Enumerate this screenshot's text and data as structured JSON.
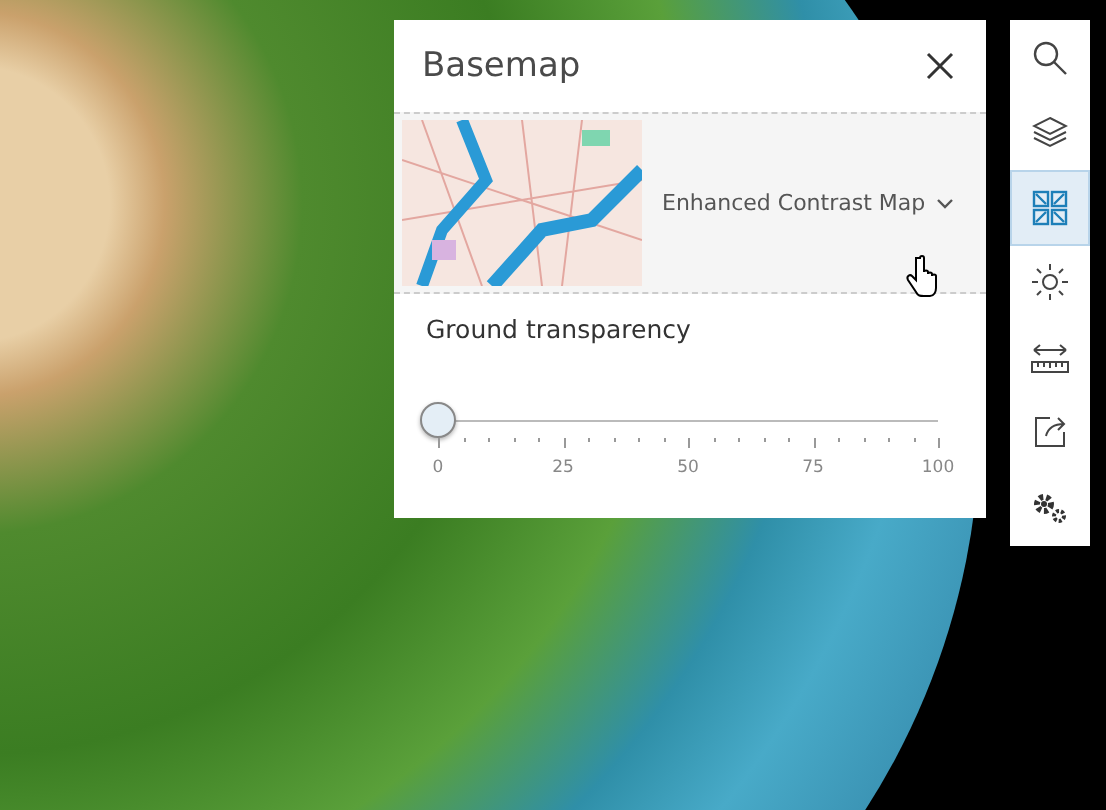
{
  "panel": {
    "title": "Basemap",
    "basemap": {
      "name": "Enhanced Contrast Map"
    },
    "slider": {
      "label": "Ground transparency",
      "level": 0,
      "ticks": [
        "0",
        "25",
        "50",
        "75",
        "100"
      ]
    }
  },
  "toolbar": [
    {
      "kind": "search",
      "selected": false
    },
    {
      "kind": "layers",
      "selected": false
    },
    {
      "kind": "basemap",
      "selected": true
    },
    {
      "kind": "daylight",
      "selected": false
    },
    {
      "kind": "measure",
      "selected": false
    },
    {
      "kind": "share",
      "selected": false
    },
    {
      "kind": "settings",
      "selected": false
    }
  ]
}
